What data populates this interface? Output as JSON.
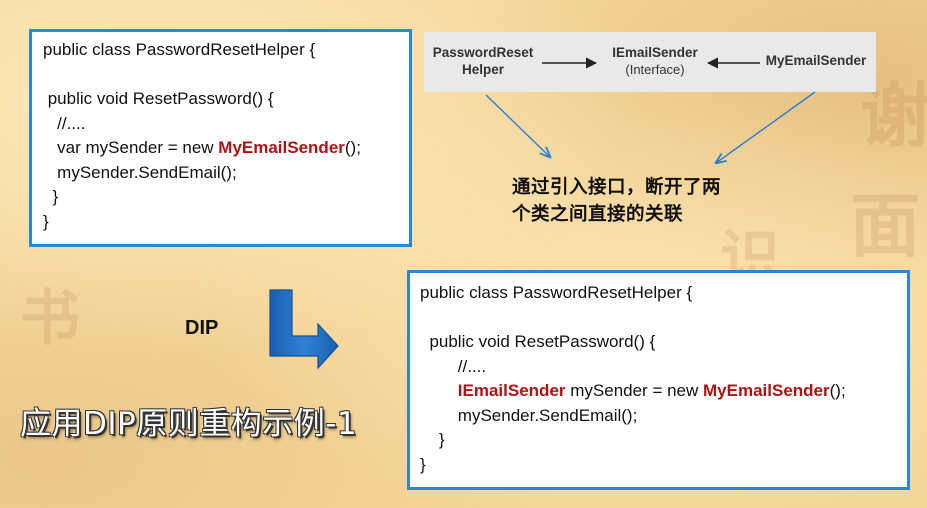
{
  "code_before": {
    "lines": [
      {
        "pre": "public class PasswordResetHelper {",
        "kw": "",
        "post": ""
      },
      {
        "pre": "",
        "kw": "",
        "post": ""
      },
      {
        "pre": " public void ResetPassword() {",
        "kw": "",
        "post": ""
      },
      {
        "pre": "   //....",
        "kw": "",
        "post": ""
      },
      {
        "pre": "   var mySender = new ",
        "kw": "MyEmailSender",
        "post": "();"
      },
      {
        "pre": "   mySender.SendEmail();",
        "kw": "",
        "post": ""
      },
      {
        "pre": "  }",
        "kw": "",
        "post": ""
      },
      {
        "pre": "}",
        "kw": "",
        "post": ""
      }
    ]
  },
  "code_after": {
    "lines": [
      {
        "pre": "public class PasswordResetHelper {",
        "kw1": "",
        "mid": "",
        "kw2": "",
        "post": ""
      },
      {
        "pre": "",
        "kw1": "",
        "mid": "",
        "kw2": "",
        "post": ""
      },
      {
        "pre": "  public void ResetPassword() {",
        "kw1": "",
        "mid": "",
        "kw2": "",
        "post": ""
      },
      {
        "pre": "        //....",
        "kw1": "",
        "mid": "",
        "kw2": "",
        "post": ""
      },
      {
        "pre": "        ",
        "kw1": "IEmailSender",
        "mid": " mySender = new ",
        "kw2": "MyEmailSender",
        "post": "();"
      },
      {
        "pre": "        mySender.SendEmail();",
        "kw1": "",
        "mid": "",
        "kw2": "",
        "post": ""
      },
      {
        "pre": "    }",
        "kw1": "",
        "mid": "",
        "kw2": "",
        "post": ""
      },
      {
        "pre": "}",
        "kw1": "",
        "mid": "",
        "kw2": "",
        "post": ""
      }
    ]
  },
  "diagram": {
    "helper_line1": "PasswordReset",
    "helper_line2": "Helper",
    "interface_line1": "IEmailSender",
    "interface_line2": "(Interface)",
    "impl": "MyEmailSender"
  },
  "annotation": {
    "line1": "通过引入接口，断开了两",
    "line2": "个类之间直接的关联"
  },
  "dip_label": "DIP",
  "title": "应用DIP原则重构示例-1",
  "colors": {
    "box_border": "#2a86d6",
    "keyword": "#b01313",
    "big_arrow": "#1f6fc7",
    "pointer_arrow": "#2a7fd4"
  }
}
